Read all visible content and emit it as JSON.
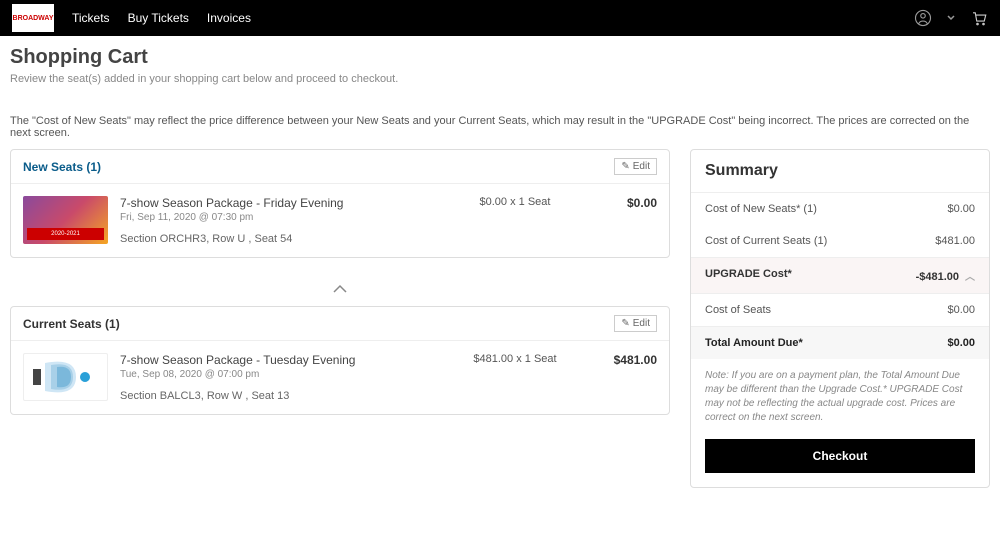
{
  "nav": {
    "logo": "BROADWAY",
    "tickets": "Tickets",
    "buy": "Buy Tickets",
    "invoices": "Invoices"
  },
  "page": {
    "title": "Shopping Cart",
    "subtitle": "Review the seat(s) added in your shopping cart below and proceed to checkout.",
    "notice": "The \"Cost of New Seats\" may reflect the price difference between your New Seats and your Current Seats, which may result in the \"UPGRADE Cost\" being incorrect. The prices are corrected on the next screen."
  },
  "newSeats": {
    "title": "New Seats (1)",
    "edit": "Edit",
    "item": {
      "name": "7-show Season Package - Friday Evening",
      "date": "Fri, Sep 11, 2020 @ 07:30 pm",
      "section": "Section ORCHR3, Row U , Seat 54",
      "priceEach": "$0.00 x 1 Seat",
      "total": "$0.00",
      "thumbLabel": "2020-2021"
    }
  },
  "currentSeats": {
    "title": "Current Seats (1)",
    "edit": "Edit",
    "item": {
      "name": "7-show Season Package - Tuesday Evening",
      "date": "Tue, Sep 08, 2020 @ 07:00 pm",
      "section": "Section BALCL3, Row W , Seat 13",
      "priceEach": "$481.00 x 1 Seat",
      "total": "$481.00"
    }
  },
  "summary": {
    "title": "Summary",
    "rows": {
      "newLabel": "Cost of New Seats* (1)",
      "newVal": "$0.00",
      "curLabel": "Cost of Current Seats (1)",
      "curVal": "$481.00",
      "upLabel": "UPGRADE Cost*",
      "upVal": "-$481.00",
      "seatsLabel": "Cost of Seats",
      "seatsVal": "$0.00",
      "totalLabel": "Total Amount Due*",
      "totalVal": "$0.00"
    },
    "note": "Note: If you are on a payment plan, the Total Amount Due may be different than the Upgrade Cost.* UPGRADE Cost may not be reflecting the actual upgrade cost. Prices are correct on the next screen.",
    "checkout": "Checkout"
  }
}
